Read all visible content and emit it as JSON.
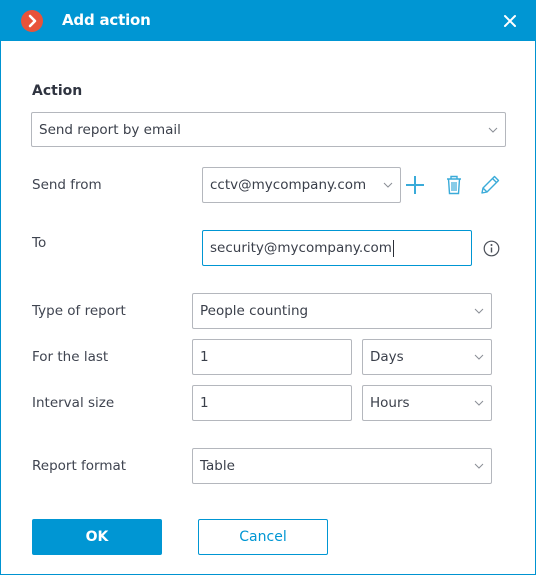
{
  "window": {
    "title": "Add action",
    "logo_icon": "chevron-right-circle-icon",
    "close_icon": "close-icon"
  },
  "action": {
    "section_title": "Action",
    "selected": "Send report by email"
  },
  "send_from": {
    "label": "Send from",
    "selected": "cctv@mycompany.com",
    "add_icon": "plus-icon",
    "delete_icon": "trash-icon",
    "edit_icon": "pencil-icon"
  },
  "to": {
    "label": "To",
    "value": "security@mycompany.com",
    "info_icon": "info-icon"
  },
  "type_of_report": {
    "label": "Type of report",
    "selected": "People counting"
  },
  "for_the_last": {
    "label": "For the last",
    "value": "1",
    "unit": "Days"
  },
  "interval_size": {
    "label": "Interval size",
    "value": "1",
    "unit": "Hours"
  },
  "report_format": {
    "label": "Report format",
    "selected": "Table"
  },
  "buttons": {
    "ok": "OK",
    "cancel": "Cancel"
  },
  "colors": {
    "accent": "#0096d3",
    "logo": "#e8533a"
  }
}
